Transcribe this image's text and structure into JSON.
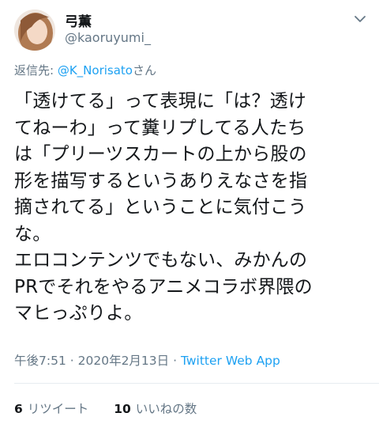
{
  "user": {
    "display_name": "弓薫",
    "handle": "@kaoruyumi_"
  },
  "reply": {
    "prefix": "返信先: ",
    "mention": "@K_Norisato",
    "suffix": "さん"
  },
  "tweet": {
    "lines": [
      "「透けてる」って表現に「は？透け",
      "てねーわ」って糞リプしてる人たち",
      "は「プリーツスカートの上から股の",
      "形を描写するというありえなさを指",
      "摘されてる」ということに気付こう",
      "な。",
      "エロコンテンツでもない、みかんの",
      "PRでそれをやるアニメコラボ界隈の",
      "マヒっぷりよ。"
    ]
  },
  "meta": {
    "time": "午後7:51",
    "date": "2020年2月13日",
    "separator": "·",
    "source": "Twitter Web App"
  },
  "stats": {
    "retweets_count": "6",
    "retweets_label": "リツイート",
    "likes_count": "10",
    "likes_label": "いいねの数"
  },
  "colors": {
    "link": "#1da1f2",
    "secondary_text": "#657786",
    "divider": "#e6ecf0"
  },
  "icons": {
    "menu": "chevron-down-icon",
    "avatar": "avatar"
  }
}
